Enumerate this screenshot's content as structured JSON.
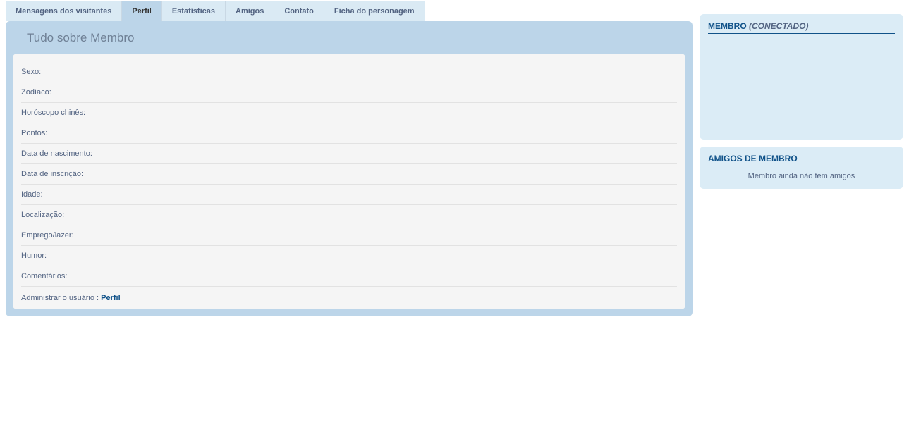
{
  "tabs": [
    {
      "label": "Mensagens dos visitantes",
      "active": false
    },
    {
      "label": "Perfil",
      "active": true
    },
    {
      "label": "Estatísticas",
      "active": false
    },
    {
      "label": "Amigos",
      "active": false
    },
    {
      "label": "Contato",
      "active": false
    },
    {
      "label": "Ficha do personagem",
      "active": false
    }
  ],
  "panel": {
    "title": "Tudo sobre Membro",
    "fields": [
      {
        "label": "Sexo:"
      },
      {
        "label": "Zodíaco:"
      },
      {
        "label": "Horóscopo chinês:"
      },
      {
        "label": "Pontos:"
      },
      {
        "label": "Data de nascimento:"
      },
      {
        "label": "Data de inscrição:"
      },
      {
        "label": "Idade:"
      },
      {
        "label": "Localização:"
      },
      {
        "label": "Emprego/lazer:"
      },
      {
        "label": "Humor:"
      },
      {
        "label": "Comentários:"
      }
    ],
    "admin_text": "Administrar o usuário : ",
    "admin_link": "Perfil"
  },
  "sidebar": {
    "member_box": {
      "title_pre": "MEMBRO ",
      "status": "(CONECTADO)"
    },
    "friends_box": {
      "title": "AMIGOS DE MEMBRO",
      "body": "Membro ainda não tem amigos"
    }
  }
}
